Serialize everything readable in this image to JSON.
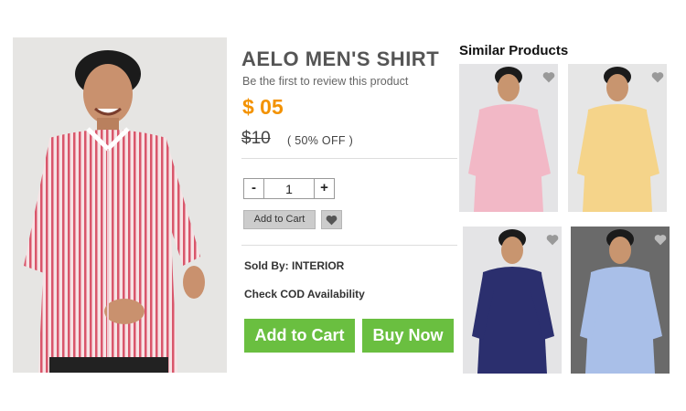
{
  "product": {
    "title": "AELO MEN'S SHIRT",
    "review_text": "Be the first to review this product",
    "price": "$ 05",
    "old_price": "$10",
    "discount": "( 50% OFF )",
    "quantity": "1",
    "qty_minus": "-",
    "qty_plus": "+",
    "small_add_to_cart": "Add to Cart",
    "sold_by": "Sold By: INTERIOR",
    "cod": "Check COD Availability",
    "add_to_cart": "Add to Cart",
    "buy_now": "Buy Now"
  },
  "similar": {
    "heading": "Similar Products",
    "items": [
      {
        "shirt_color": "#f2b8c6"
      },
      {
        "shirt_color": "#f5d48a"
      },
      {
        "shirt_color": "#2b2f6e"
      },
      {
        "shirt_color": "#a9bfe8"
      }
    ]
  },
  "colors": {
    "price": "#f39200",
    "button_green": "#6abf40",
    "main_shirt": "#e98a98"
  },
  "icons": [
    "heart-icon"
  ]
}
